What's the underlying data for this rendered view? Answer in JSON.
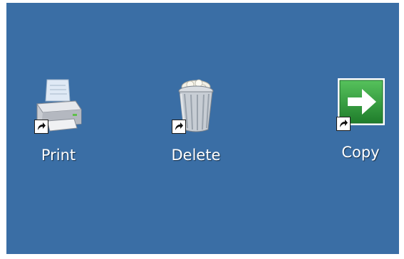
{
  "desktop": {
    "background_color": "#3a6ea5",
    "shortcuts": [
      {
        "label": "Print",
        "icon": "printer-icon",
        "overlay": "shortcut-arrow-icon"
      },
      {
        "label": "Delete",
        "icon": "recycle-bin-icon",
        "overlay": "shortcut-arrow-icon"
      },
      {
        "label": "Copy",
        "icon": "green-arrow-icon",
        "overlay": "shortcut-arrow-icon"
      }
    ]
  },
  "colors": {
    "label_text": "#ffffff",
    "copy_icon_green": "#2e9a3a"
  }
}
